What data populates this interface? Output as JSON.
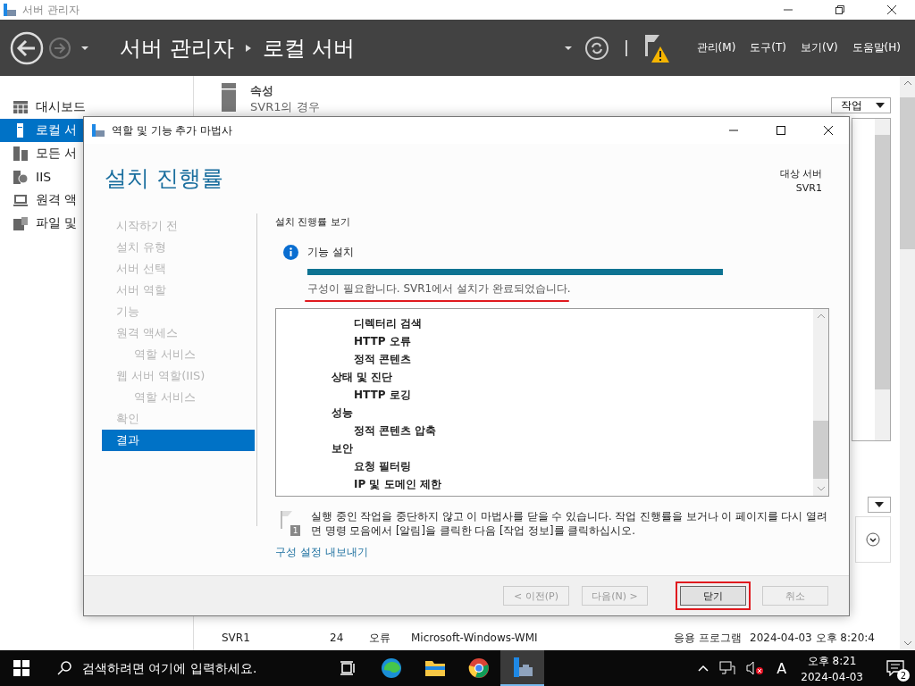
{
  "window": {
    "title": "서버 관리자"
  },
  "header": {
    "breadcrumb": [
      "서버 관리자",
      "로컬 서버"
    ],
    "menus": [
      "관리(M)",
      "도구(T)",
      "보기(V)",
      "도움말(H)"
    ]
  },
  "sidebar": {
    "items": [
      {
        "label": "대시보드",
        "selected": false
      },
      {
        "label": "로컬 서",
        "selected": true
      },
      {
        "label": "모든 서",
        "selected": false
      },
      {
        "label": "IIS",
        "selected": false
      },
      {
        "label": "원격 액",
        "selected": false
      },
      {
        "label": "파일 및",
        "selected": false
      }
    ]
  },
  "properties": {
    "title": "속성",
    "subtitle": "SVR1의 경우",
    "tasks_button": "작업"
  },
  "events": {
    "rows": [
      {
        "server": "SVR1",
        "id": "24",
        "severity": "오류",
        "source": "Microsoft-Windows-WMI",
        "log": "응용 프로그램",
        "date": "2024-04-03 오후 8:20:4"
      }
    ]
  },
  "dialog": {
    "title": "역할 및 기능 추가 마법사",
    "heading": "설치 진행률",
    "target_label": "대상 서버",
    "target": "SVR1",
    "nav": [
      {
        "label": "시작하기 전",
        "selected": false
      },
      {
        "label": "설치 유형",
        "selected": false
      },
      {
        "label": "서버 선택",
        "selected": false
      },
      {
        "label": "서버 역할",
        "selected": false
      },
      {
        "label": "기능",
        "selected": false
      },
      {
        "label": "원격 액세스",
        "selected": false,
        "children": [
          {
            "label": "역할 서비스",
            "selected": false
          }
        ]
      },
      {
        "label": "웹 서버 역할(IIS)",
        "selected": false,
        "children": [
          {
            "label": "역할 서비스",
            "selected": false
          }
        ]
      },
      {
        "label": "확인",
        "selected": false
      },
      {
        "label": "결과",
        "selected": true
      }
    ],
    "section_title": "설치 진행률 보기",
    "status": {
      "title": "기능 설치",
      "level": 1,
      "message": "구성이 필요합니다. SVR1에서 설치가 완료되었습니다.",
      "annotated": true
    },
    "tree": [
      {
        "children": [
          {
            "label": "디렉터리 검색"
          },
          {
            "label": "HTTP 오류"
          },
          {
            "label": "정적 콘텐츠"
          }
        ]
      },
      {
        "label": "상태 및 진단",
        "children": [
          {
            "label": "HTTP 로깅"
          }
        ]
      },
      {
        "label": "성능",
        "children": [
          {
            "label": "정적 콘텐츠 압축"
          }
        ]
      },
      {
        "label": "보안",
        "children": [
          {
            "label": "요청 필터링"
          },
          {
            "label": "IP 및 도메인 제한"
          }
        ]
      }
    ],
    "note": {
      "badge": "1",
      "text": "실행 중인 작업을 중단하지 않고 이 마법사를 닫을 수 있습니다. 작업 진행률을 보거나 이 페이지를 다시 열려면 명령 모음에서 [알림]을 클릭한 다음 [작업 정보]를 클릭하십시오."
    },
    "link": "구성 설정 내보내기",
    "buttons": [
      {
        "label": "< 이전(P)",
        "disabled": true,
        "annotated": false
      },
      {
        "label": "다음(N) >",
        "disabled": true,
        "annotated": false
      },
      {
        "label": "닫기",
        "disabled": false,
        "annotated": true
      },
      {
        "label": "취소",
        "disabled": true,
        "annotated": false
      }
    ]
  },
  "taskbar": {
    "search": {
      "placeholder": "검색하려면 여기에 입력하세요."
    },
    "tray_letter": "A",
    "time": "오후 8:21",
    "date": "2024-04-03",
    "notifications": "2"
  }
}
